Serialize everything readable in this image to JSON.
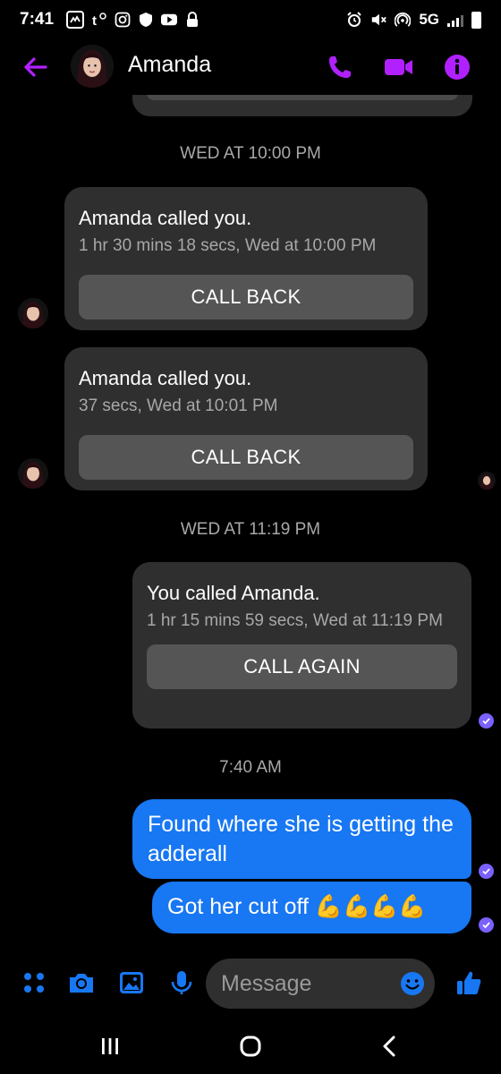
{
  "status_bar": {
    "time": "7:41",
    "network": "5G",
    "icons": [
      "messenger-notification-icon",
      "tmobile-icon",
      "instagram-icon",
      "shield-icon",
      "youtube-icon",
      "lock-icon",
      "alarm-icon",
      "mute-icon",
      "hotspot-icon",
      "signal-icon",
      "battery-icon"
    ]
  },
  "header": {
    "contact_name": "Amanda",
    "accent_color": "#b121ff"
  },
  "messages": {
    "timestamp_1": "WED AT 10:00 PM",
    "call_1": {
      "title": "Amanda called you.",
      "detail": "1 hr 30 mins 18 secs, Wed at 10:00 PM",
      "button": "CALL BACK"
    },
    "call_2": {
      "title": "Amanda called you.",
      "detail": "37 secs, Wed at 10:01 PM",
      "button": "CALL BACK"
    },
    "timestamp_2": "WED AT 11:19 PM",
    "call_3": {
      "title": "You called Amanda.",
      "detail": "1 hr 15 mins 59 secs, Wed at 11:19 PM",
      "button": "CALL AGAIN"
    },
    "timestamp_3": "7:40 AM",
    "sent_1": "Found where she is getting the adderall",
    "sent_2": "Got her cut off 💪💪💪💪"
  },
  "composer": {
    "placeholder": "Message",
    "accent_color": "#1877f2"
  }
}
